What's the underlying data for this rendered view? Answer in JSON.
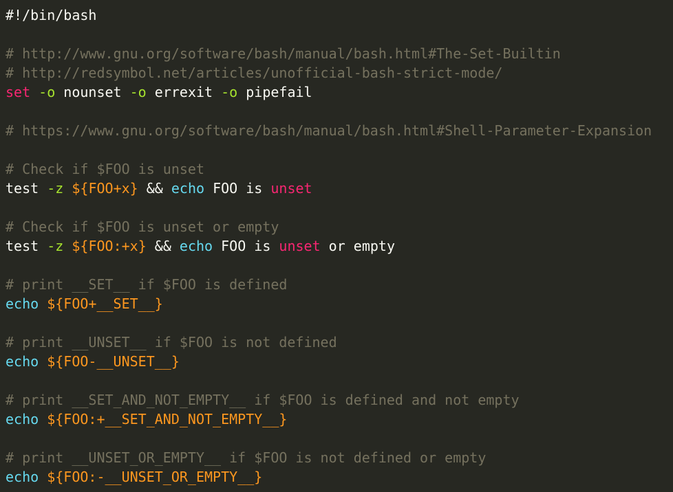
{
  "colors": {
    "background": "#272822",
    "plain": "#f8f8f2",
    "comment": "#75715e",
    "keyword": "#f92672",
    "flag": "#a6e22e",
    "builtin": "#66d9ef",
    "var": "#fd971f"
  },
  "lines": [
    {
      "tokens": [
        {
          "t": "#!/bin/bash",
          "c": "plain"
        }
      ]
    },
    {
      "tokens": []
    },
    {
      "tokens": [
        {
          "t": "# http://www.gnu.org/software/bash/manual/bash.html#The-Set-Builtin",
          "c": "comment"
        }
      ]
    },
    {
      "tokens": [
        {
          "t": "# http://redsymbol.net/articles/unofficial-bash-strict-mode/",
          "c": "comment"
        }
      ]
    },
    {
      "tokens": [
        {
          "t": "set",
          "c": "keyword"
        },
        {
          "t": " ",
          "c": "plain"
        },
        {
          "t": "-o",
          "c": "flag"
        },
        {
          "t": " nounset ",
          "c": "plain"
        },
        {
          "t": "-o",
          "c": "flag"
        },
        {
          "t": " errexit ",
          "c": "plain"
        },
        {
          "t": "-o",
          "c": "flag"
        },
        {
          "t": " pipefail",
          "c": "plain"
        }
      ]
    },
    {
      "tokens": []
    },
    {
      "tokens": [
        {
          "t": "# https://www.gnu.org/software/bash/manual/bash.html#Shell-Parameter-Expansion",
          "c": "comment"
        }
      ]
    },
    {
      "tokens": []
    },
    {
      "tokens": [
        {
          "t": "# Check if $FOO is unset",
          "c": "comment"
        }
      ]
    },
    {
      "tokens": [
        {
          "t": "test ",
          "c": "plain"
        },
        {
          "t": "-z",
          "c": "flag"
        },
        {
          "t": " ",
          "c": "plain"
        },
        {
          "t": "${FOO+x}",
          "c": "var"
        },
        {
          "t": " && ",
          "c": "plain"
        },
        {
          "t": "echo",
          "c": "builtin"
        },
        {
          "t": " FOO is ",
          "c": "plain"
        },
        {
          "t": "unset",
          "c": "keyword"
        }
      ]
    },
    {
      "tokens": []
    },
    {
      "tokens": [
        {
          "t": "# Check if $FOO is unset or empty",
          "c": "comment"
        }
      ]
    },
    {
      "tokens": [
        {
          "t": "test ",
          "c": "plain"
        },
        {
          "t": "-z",
          "c": "flag"
        },
        {
          "t": " ",
          "c": "plain"
        },
        {
          "t": "${FOO:+x}",
          "c": "var"
        },
        {
          "t": " && ",
          "c": "plain"
        },
        {
          "t": "echo",
          "c": "builtin"
        },
        {
          "t": " FOO is ",
          "c": "plain"
        },
        {
          "t": "unset",
          "c": "keyword"
        },
        {
          "t": " or empty",
          "c": "plain"
        }
      ]
    },
    {
      "tokens": []
    },
    {
      "tokens": [
        {
          "t": "# print __SET__ if $FOO is defined",
          "c": "comment"
        }
      ]
    },
    {
      "tokens": [
        {
          "t": "echo",
          "c": "builtin"
        },
        {
          "t": " ",
          "c": "plain"
        },
        {
          "t": "${FOO+__SET__}",
          "c": "var"
        }
      ]
    },
    {
      "tokens": []
    },
    {
      "tokens": [
        {
          "t": "# print __UNSET__ if $FOO is not defined",
          "c": "comment"
        }
      ]
    },
    {
      "tokens": [
        {
          "t": "echo",
          "c": "builtin"
        },
        {
          "t": " ",
          "c": "plain"
        },
        {
          "t": "${FOO-__UNSET__}",
          "c": "var"
        }
      ]
    },
    {
      "tokens": []
    },
    {
      "tokens": [
        {
          "t": "# print __SET_AND_NOT_EMPTY__ if $FOO is defined and not empty",
          "c": "comment"
        }
      ]
    },
    {
      "tokens": [
        {
          "t": "echo",
          "c": "builtin"
        },
        {
          "t": " ",
          "c": "plain"
        },
        {
          "t": "${FOO:+__SET_AND_NOT_EMPTY__}",
          "c": "var"
        }
      ]
    },
    {
      "tokens": []
    },
    {
      "tokens": [
        {
          "t": "# print __UNSET_OR_EMPTY__ if $FOO is not defined or empty",
          "c": "comment"
        }
      ]
    },
    {
      "tokens": [
        {
          "t": "echo",
          "c": "builtin"
        },
        {
          "t": " ",
          "c": "plain"
        },
        {
          "t": "${FOO:-__UNSET_OR_EMPTY__}",
          "c": "var"
        }
      ]
    }
  ]
}
